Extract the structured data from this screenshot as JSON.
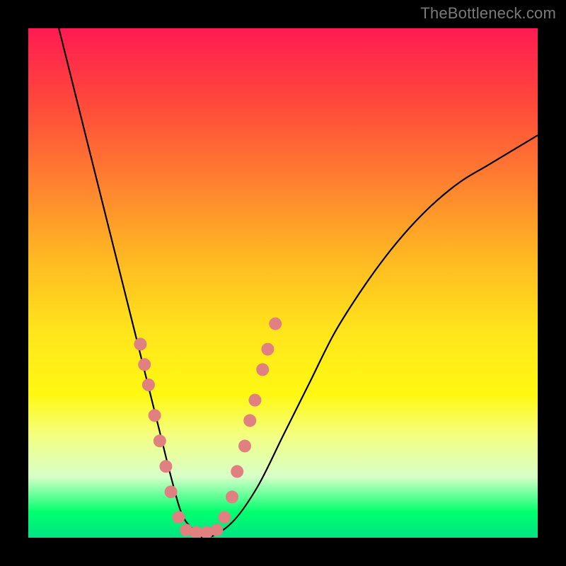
{
  "watermark": "TheBottleneck.com",
  "chart_data": {
    "type": "line",
    "title": "",
    "xlabel": "",
    "ylabel": "",
    "xlim": [
      0,
      100
    ],
    "ylim": [
      0,
      100
    ],
    "grid": false,
    "legend": false,
    "background_gradient": {
      "stops": [
        {
          "pos": 0.0,
          "color": "#ff1b52"
        },
        {
          "pos": 0.15,
          "color": "#ff4a3a"
        },
        {
          "pos": 0.3,
          "color": "#ff8030"
        },
        {
          "pos": 0.45,
          "color": "#ffb822"
        },
        {
          "pos": 0.6,
          "color": "#ffe61b"
        },
        {
          "pos": 0.72,
          "color": "#fff812"
        },
        {
          "pos": 0.8,
          "color": "#f4ff82"
        },
        {
          "pos": 0.88,
          "color": "#d8ffc8"
        },
        {
          "pos": 0.95,
          "color": "#00ff6e"
        },
        {
          "pos": 1.0,
          "color": "#00e484"
        }
      ]
    },
    "series": [
      {
        "name": "bottleneck-curve",
        "color": "#000000",
        "x": [
          6,
          8,
          10,
          12,
          14,
          16,
          18,
          20,
          22,
          24,
          26,
          28,
          30,
          32,
          35,
          40,
          45,
          50,
          55,
          60,
          65,
          70,
          75,
          80,
          85,
          90,
          95,
          100
        ],
        "y": [
          100,
          92,
          84,
          76,
          68,
          60,
          52,
          44,
          36,
          28,
          20,
          12,
          5,
          2,
          0,
          3,
          10,
          20,
          30,
          40,
          48,
          55,
          61,
          66,
          70,
          73,
          76,
          79
        ]
      }
    ],
    "scatter_overlay": {
      "name": "data-points",
      "color": "#e08080",
      "radius_px": 9,
      "points": [
        {
          "x": 22.0,
          "y": 38
        },
        {
          "x": 22.8,
          "y": 34
        },
        {
          "x": 23.6,
          "y": 30
        },
        {
          "x": 24.8,
          "y": 24
        },
        {
          "x": 25.8,
          "y": 19
        },
        {
          "x": 27.0,
          "y": 14
        },
        {
          "x": 28.0,
          "y": 9
        },
        {
          "x": 29.5,
          "y": 4
        },
        {
          "x": 31.0,
          "y": 1.5
        },
        {
          "x": 33.0,
          "y": 1.0
        },
        {
          "x": 35.0,
          "y": 1.0
        },
        {
          "x": 37.0,
          "y": 1.5
        },
        {
          "x": 38.5,
          "y": 4
        },
        {
          "x": 40.0,
          "y": 8
        },
        {
          "x": 41.0,
          "y": 13
        },
        {
          "x": 42.5,
          "y": 18
        },
        {
          "x": 43.5,
          "y": 23
        },
        {
          "x": 44.5,
          "y": 27
        },
        {
          "x": 46.0,
          "y": 33
        },
        {
          "x": 47.0,
          "y": 37
        },
        {
          "x": 48.5,
          "y": 42
        }
      ]
    }
  }
}
